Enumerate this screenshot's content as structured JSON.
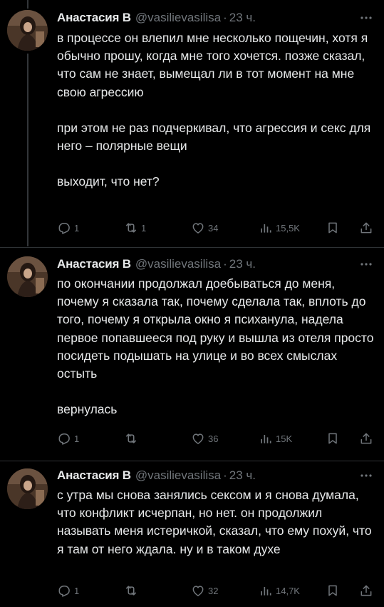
{
  "colors": {
    "background": "#000000",
    "text_primary": "#e7e9ea",
    "text_secondary": "#71767b",
    "separator": "#2f3336"
  },
  "tweets": [
    {
      "name": "Анастасия В",
      "handle": "@vasilievasilisa",
      "dot": "·",
      "time": "23 ч.",
      "paragraphs": [
        "в процессе он влепил мне несколько пощечин, хотя я обычно прошу, когда мне того хочется. позже сказал, что сам не знает, вымещал ли в тот момент на мне свою агрессию",
        "при этом не раз подчеркивал, что агрессия и секс для него – полярные вещи",
        "выходит, что нет?"
      ],
      "replies": "1",
      "retweets": "1",
      "likes": "34",
      "views": "15,5K",
      "icons": [
        "reply-icon",
        "retweet-icon",
        "like-icon",
        "views-icon",
        "bookmark-icon",
        "share-icon"
      ]
    },
    {
      "name": "Анастасия В",
      "handle": "@vasilievasilisa",
      "dot": "·",
      "time": "23 ч.",
      "paragraphs": [
        "по окончании продолжал доебываться до меня, почему я сказала так, почему сделала так, вплоть до того, почему я открыла окно я психанула, надела первое попавшееся под руку и вышла из отеля просто посидеть подышать на улице и во всех смыслах остыть",
        "вернулась"
      ],
      "replies": "1",
      "retweets": "",
      "likes": "36",
      "views": "15K",
      "icons": [
        "reply-icon",
        "retweet-icon",
        "like-icon",
        "views-icon",
        "bookmark-icon",
        "share-icon"
      ]
    },
    {
      "name": "Анастасия В",
      "handle": "@vasilievasilisa",
      "dot": "·",
      "time": "23 ч.",
      "paragraphs": [
        "с утра мы снова занялись сексом и я снова думала, что конфликт исчерпан, но нет. он продолжил называть меня истеричкой, сказал, что ему похуй, что я там от него ждала. ну и в таком духе"
      ],
      "replies": "1",
      "retweets": "",
      "likes": "32",
      "views": "14,7K",
      "icons": [
        "reply-icon",
        "retweet-icon",
        "like-icon",
        "views-icon",
        "bookmark-icon",
        "share-icon"
      ]
    }
  ]
}
